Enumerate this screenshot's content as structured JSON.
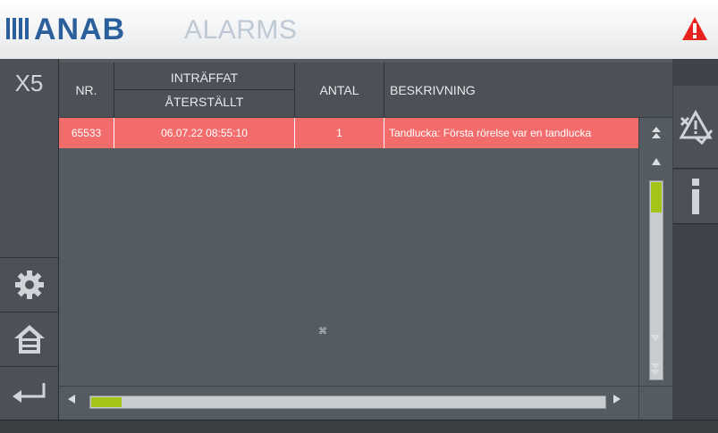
{
  "header": {
    "logo": "ANAB",
    "title": "ALARMS"
  },
  "sidebar": {
    "station": "X5",
    "buttons": [
      {
        "name": "settings",
        "icon": "gear-icon"
      },
      {
        "name": "home",
        "icon": "home-icon"
      },
      {
        "name": "back",
        "icon": "return-arrow-icon"
      }
    ]
  },
  "table": {
    "columns": {
      "nr": "NR.",
      "occurred": "INTRÄFFAT",
      "reset": "ÅTERSTÄLLT",
      "count": "ANTAL",
      "description": "BESKRIVNING"
    },
    "rows": [
      {
        "nr": "65533",
        "occurred": "06.07.22  08:55:10",
        "count": "1",
        "description": "Tandlucka: Första rörelse var en tandlucka"
      }
    ],
    "center_mark": "⌘"
  },
  "scroll": {
    "vertical_position": 0.0,
    "horizontal_position": 0.0
  },
  "right_panel": {
    "buttons": [
      {
        "name": "acknowledge-alarms",
        "icon": "alarm-ack-icon"
      },
      {
        "name": "info",
        "icon": "info-icon"
      }
    ]
  },
  "colors": {
    "brand": "#2b5f9c",
    "alarm_row": "#f26c6c",
    "warning": "#e8231d",
    "scroll_thumb": "#a4c41a"
  }
}
